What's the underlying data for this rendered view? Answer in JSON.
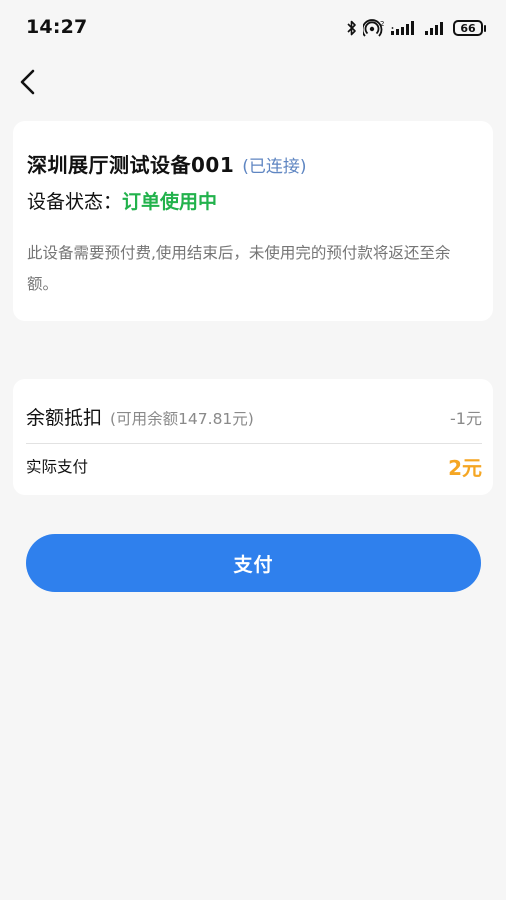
{
  "status_bar": {
    "time": "14:27",
    "battery": "66",
    "icons": [
      "bluetooth-icon",
      "hotspot-icon",
      "signal-icon",
      "signal-icon",
      "battery-icon"
    ]
  },
  "header": {
    "back_icon": "chevron-left-icon"
  },
  "device": {
    "name": "深圳展厅测试设备001",
    "connection": "(已连接)",
    "status_label": "设备状态：",
    "status_value": "订单使用中",
    "description": "此设备需要预付费,使用结束后，未使用完的预付款将返还至余额。"
  },
  "payment": {
    "balance_label": "余额抵扣",
    "balance_available": "(可用余额147.81元)",
    "balance_deduct": "-1元",
    "actual_label": "实际支付",
    "actual_amount": "2元"
  },
  "actions": {
    "pay_label": "支付"
  },
  "colors": {
    "accent": "#2f80ed",
    "status_green": "#22b24c",
    "amount_orange": "#f5a623",
    "link_blue": "#5f86c2"
  }
}
